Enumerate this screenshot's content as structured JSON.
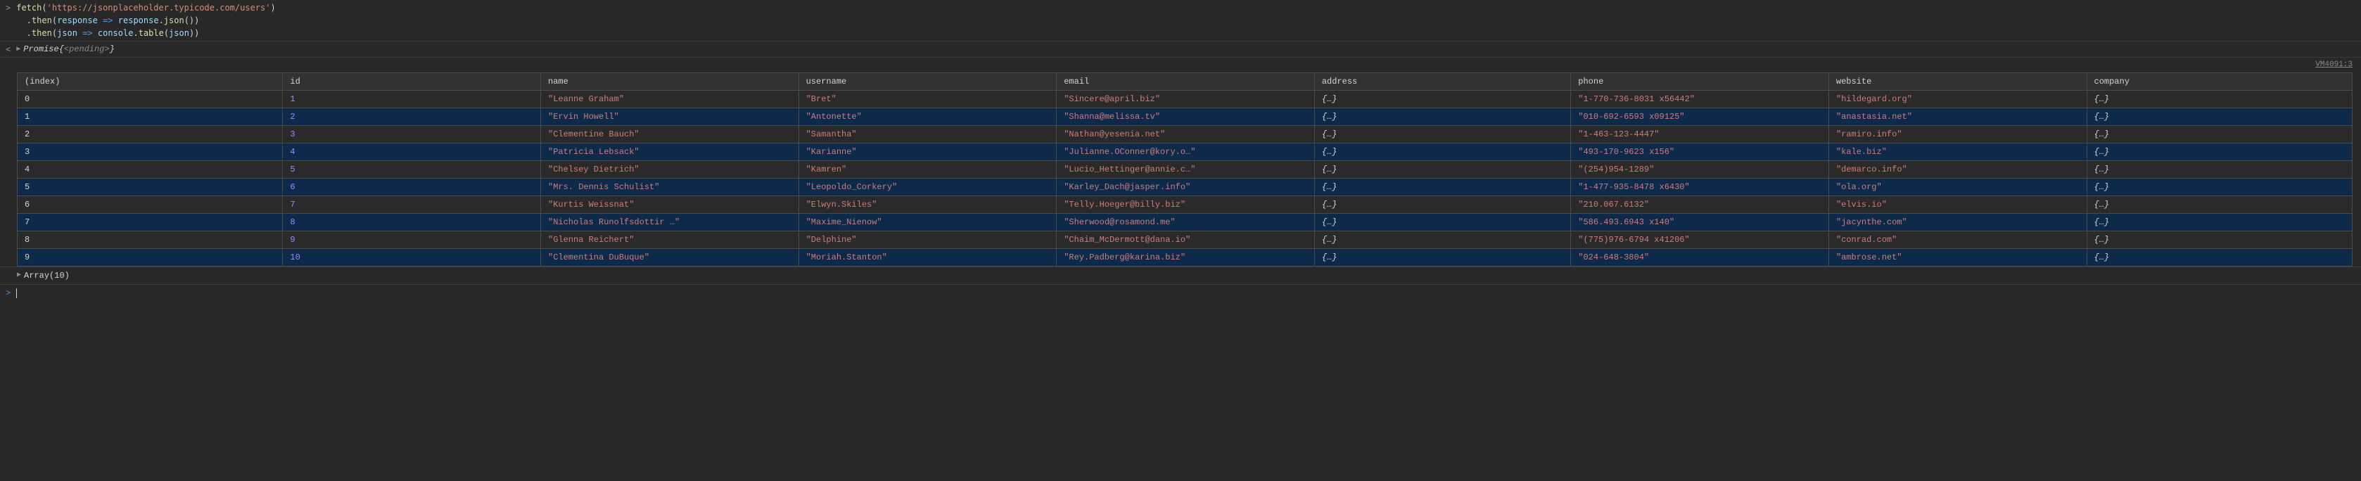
{
  "input": {
    "line1_a": "fetch",
    "line1_b": "(",
    "line1_c": "'https://jsonplaceholder.typicode.com/users'",
    "line1_d": ")",
    "line2_a": "  .",
    "line2_b": "then",
    "line2_c": "(",
    "line2_d": "response",
    "line2_e": " => ",
    "line2_f": "response",
    "line2_g": ".",
    "line2_h": "json",
    "line2_i": "())",
    "line3_a": "  .",
    "line3_b": "then",
    "line3_c": "(",
    "line3_d": "json",
    "line3_e": " => ",
    "line3_f": "console",
    "line3_g": ".",
    "line3_h": "table",
    "line3_i": "(",
    "line3_j": "json",
    "line3_k": "))"
  },
  "result": {
    "cls": "Promise ",
    "open": "{",
    "state": "<pending>",
    "close": "}"
  },
  "vm": "VM4091:3",
  "headers": {
    "index": "(index)",
    "id": "id",
    "name": "name",
    "username": "username",
    "email": "email",
    "address": "address",
    "phone": "phone",
    "website": "website",
    "company": "company"
  },
  "rows": [
    {
      "idx": "0",
      "id": "1",
      "name": "\"Leanne Graham\"",
      "username": "\"Bret\"",
      "email": "\"Sincere@april.biz\"",
      "address": "{…}",
      "phone": "\"1-770-736-8031 x56442\"",
      "website": "\"hildegard.org\"",
      "company": "{…}"
    },
    {
      "idx": "1",
      "id": "2",
      "name": "\"Ervin Howell\"",
      "username": "\"Antonette\"",
      "email": "\"Shanna@melissa.tv\"",
      "address": "{…}",
      "phone": "\"010-692-6593 x09125\"",
      "website": "\"anastasia.net\"",
      "company": "{…}"
    },
    {
      "idx": "2",
      "id": "3",
      "name": "\"Clementine Bauch\"",
      "username": "\"Samantha\"",
      "email": "\"Nathan@yesenia.net\"",
      "address": "{…}",
      "phone": "\"1-463-123-4447\"",
      "website": "\"ramiro.info\"",
      "company": "{…}"
    },
    {
      "idx": "3",
      "id": "4",
      "name": "\"Patricia Lebsack\"",
      "username": "\"Karianne\"",
      "email": "\"Julianne.OConner@kory.o…\"",
      "address": "{…}",
      "phone": "\"493-170-9623 x156\"",
      "website": "\"kale.biz\"",
      "company": "{…}"
    },
    {
      "idx": "4",
      "id": "5",
      "name": "\"Chelsey Dietrich\"",
      "username": "\"Kamren\"",
      "email": "\"Lucio_Hettinger@annie.c…\"",
      "address": "{…}",
      "phone": "\"(254)954-1289\"",
      "website": "\"demarco.info\"",
      "company": "{…}"
    },
    {
      "idx": "5",
      "id": "6",
      "name": "\"Mrs. Dennis Schulist\"",
      "username": "\"Leopoldo_Corkery\"",
      "email": "\"Karley_Dach@jasper.info\"",
      "address": "{…}",
      "phone": "\"1-477-935-8478 x6430\"",
      "website": "\"ola.org\"",
      "company": "{…}"
    },
    {
      "idx": "6",
      "id": "7",
      "name": "\"Kurtis Weissnat\"",
      "username": "\"Elwyn.Skiles\"",
      "email": "\"Telly.Hoeger@billy.biz\"",
      "address": "{…}",
      "phone": "\"210.067.6132\"",
      "website": "\"elvis.io\"",
      "company": "{…}"
    },
    {
      "idx": "7",
      "id": "8",
      "name": "\"Nicholas Runolfsdottir …\"",
      "username": "\"Maxime_Nienow\"",
      "email": "\"Sherwood@rosamond.me\"",
      "address": "{…}",
      "phone": "\"586.493.6943 x140\"",
      "website": "\"jacynthe.com\"",
      "company": "{…}"
    },
    {
      "idx": "8",
      "id": "9",
      "name": "\"Glenna Reichert\"",
      "username": "\"Delphine\"",
      "email": "\"Chaim_McDermott@dana.io\"",
      "address": "{…}",
      "phone": "\"(775)976-6794 x41206\"",
      "website": "\"conrad.com\"",
      "company": "{…}"
    },
    {
      "idx": "9",
      "id": "10",
      "name": "\"Clementina DuBuque\"",
      "username": "\"Moriah.Stanton\"",
      "email": "\"Rey.Padberg@karina.biz\"",
      "address": "{…}",
      "phone": "\"024-648-3804\"",
      "website": "\"ambrose.net\"",
      "company": "{…}"
    }
  ],
  "array_label": "Array(10)",
  "chart_data": {
    "type": "table",
    "columns": [
      "(index)",
      "id",
      "name",
      "username",
      "email",
      "address",
      "phone",
      "website",
      "company"
    ],
    "rows": [
      [
        0,
        1,
        "Leanne Graham",
        "Bret",
        "Sincere@april.biz",
        "{…}",
        "1-770-736-8031 x56442",
        "hildegard.org",
        "{…}"
      ],
      [
        1,
        2,
        "Ervin Howell",
        "Antonette",
        "Shanna@melissa.tv",
        "{…}",
        "010-692-6593 x09125",
        "anastasia.net",
        "{…}"
      ],
      [
        2,
        3,
        "Clementine Bauch",
        "Samantha",
        "Nathan@yesenia.net",
        "{…}",
        "1-463-123-4447",
        "ramiro.info",
        "{…}"
      ],
      [
        3,
        4,
        "Patricia Lebsack",
        "Karianne",
        "Julianne.OConner@kory.o…",
        "{…}",
        "493-170-9623 x156",
        "kale.biz",
        "{…}"
      ],
      [
        4,
        5,
        "Chelsey Dietrich",
        "Kamren",
        "Lucio_Hettinger@annie.c…",
        "{…}",
        "(254)954-1289",
        "demarco.info",
        "{…}"
      ],
      [
        5,
        6,
        "Mrs. Dennis Schulist",
        "Leopoldo_Corkery",
        "Karley_Dach@jasper.info",
        "{…}",
        "1-477-935-8478 x6430",
        "ola.org",
        "{…}"
      ],
      [
        6,
        7,
        "Kurtis Weissnat",
        "Elwyn.Skiles",
        "Telly.Hoeger@billy.biz",
        "{…}",
        "210.067.6132",
        "elvis.io",
        "{…}"
      ],
      [
        7,
        8,
        "Nicholas Runolfsdottir …",
        "Maxime_Nienow",
        "Sherwood@rosamond.me",
        "{…}",
        "586.493.6943 x140",
        "jacynthe.com",
        "{…}"
      ],
      [
        8,
        9,
        "Glenna Reichert",
        "Delphine",
        "Chaim_McDermott@dana.io",
        "{…}",
        "(775)976-6794 x41206",
        "conrad.com",
        "{…}"
      ],
      [
        9,
        10,
        "Clementina DuBuque",
        "Moriah.Stanton",
        "Rey.Padberg@karina.biz",
        "{…}",
        "024-648-3804",
        "ambrose.net",
        "{…}"
      ]
    ]
  }
}
